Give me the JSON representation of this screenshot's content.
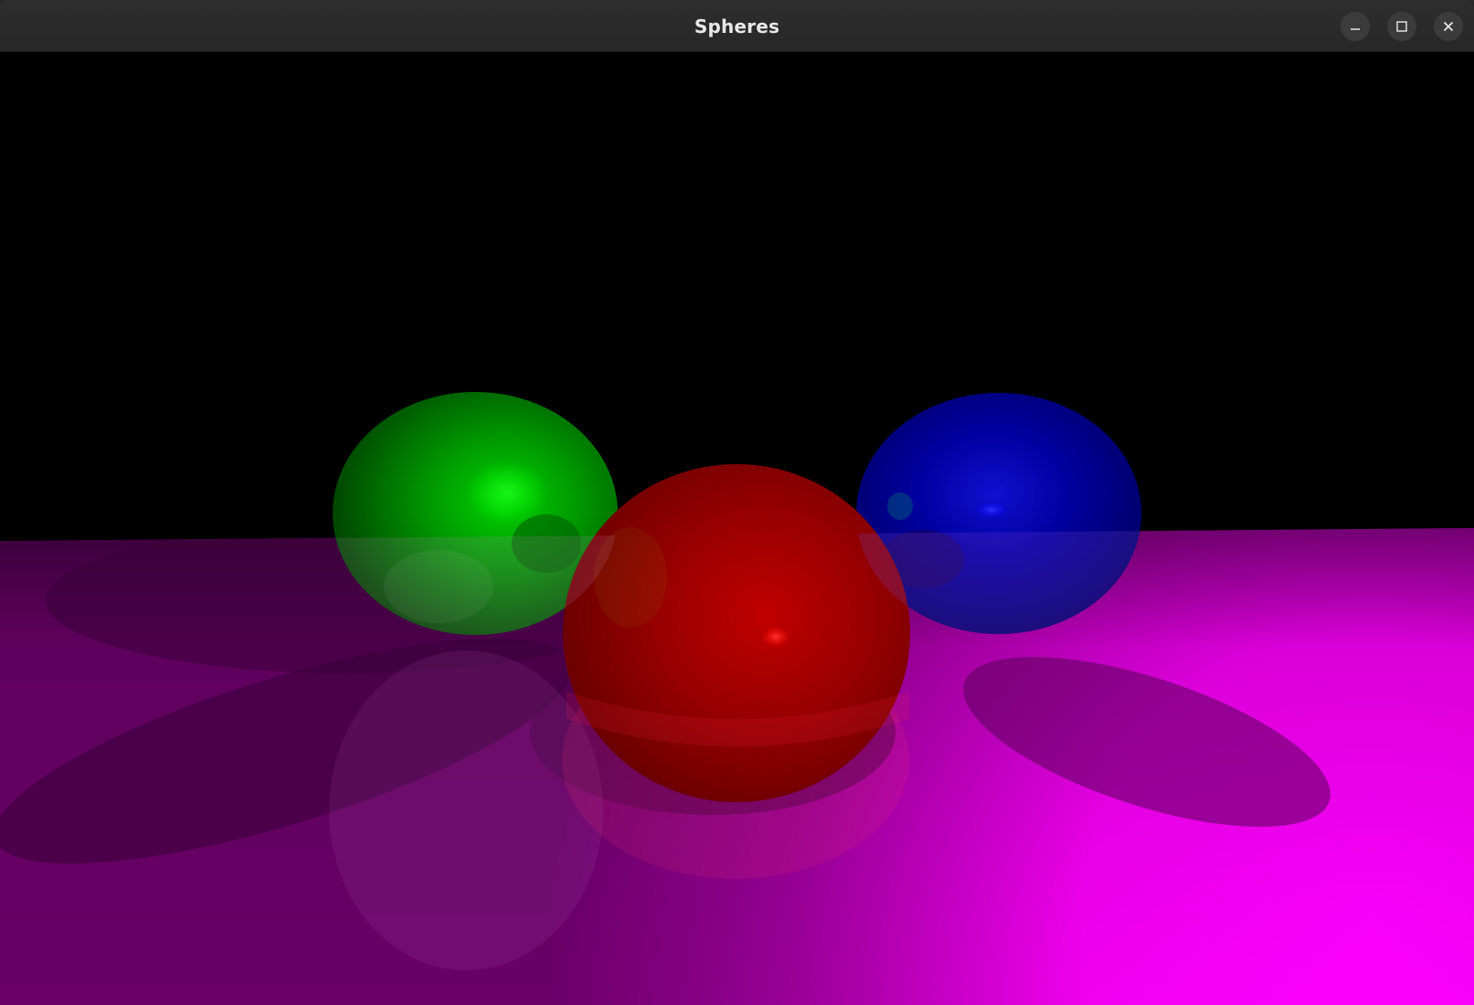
{
  "window": {
    "title": "Spheres"
  },
  "controls": {
    "minimize_icon": "minimize-icon",
    "maximize_icon": "maximize-icon",
    "close_icon": "close-icon"
  },
  "scene": {
    "background_color": "#000000",
    "floor_color_dark": "#6a0068",
    "floor_color_bright": "#ff00ff",
    "spheres": [
      {
        "name": "green",
        "color": "#00c000"
      },
      {
        "name": "red",
        "color": "#b00000"
      },
      {
        "name": "blue",
        "color": "#0000b0"
      }
    ]
  }
}
